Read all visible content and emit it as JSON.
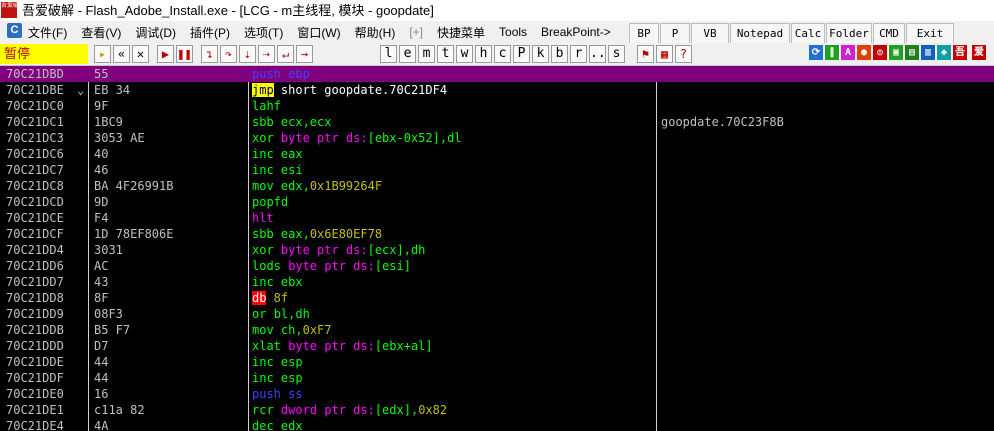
{
  "window": {
    "title": "吾爱破解 - Flash_Adobe_Install.exe - [LCG - m主线程, 模块 - goopdate]",
    "logo_text": "吾爱破解"
  },
  "menu": {
    "logo": "C",
    "items": [
      "文件(F)",
      "查看(V)",
      "调试(D)",
      "插件(P)",
      "选项(T)",
      "窗口(W)",
      "帮助(H)",
      "[+]",
      "快捷菜单",
      "Tools",
      "BreakPoint->"
    ]
  },
  "quickbar": [
    "BP",
    "P",
    "VB",
    "Notepad",
    "Calc",
    "Folder",
    "CMD",
    "Exit"
  ],
  "toolbar": {
    "status": "暂停",
    "letters": [
      "l",
      "e",
      "m",
      "t",
      "w",
      "h",
      "c",
      "P",
      "k",
      "b",
      "r",
      "...",
      "s"
    ],
    "right_icons": [
      "refresh-icon",
      "pause-bars-icon",
      "A-icon",
      "stop-circle-icon",
      "target-icon",
      "plugin-icon",
      "debug-icon",
      "stack-icon",
      "logo-icon",
      "heart-icon",
      "app-icon"
    ],
    "right_labels": [
      "吾",
      "爱"
    ]
  },
  "colors": {
    "selected_row": "#800080",
    "mnemonic": "#00ff00",
    "keyword": "#ff00ff",
    "constant": "#c0c000",
    "highlight_jmp": "#ffff00",
    "highlight_db": "#ff0000"
  },
  "disasm": [
    {
      "addr": "70C21DBD",
      "hex": "55",
      "segs": [
        {
          "t": "push ",
          "c": "push"
        },
        {
          "t": "ebp",
          "c": "reg"
        }
      ],
      "comment": "",
      "selected": true
    },
    {
      "addr": "70C21DBE",
      "hex": "EB 34",
      "arrow": "⌄",
      "segs": [
        {
          "t": "jmp",
          "c": "jmp"
        },
        {
          "t": " short goopdate.70C21DF4",
          "c": "white"
        }
      ],
      "comment": ""
    },
    {
      "addr": "70C21DC0",
      "hex": "9F",
      "segs": [
        {
          "t": "lahf",
          "c": "ins"
        }
      ],
      "comment": ""
    },
    {
      "addr": "70C21DC1",
      "hex": "1BC9",
      "segs": [
        {
          "t": "sbb ",
          "c": "ins"
        },
        {
          "t": "ecx,ecx",
          "c": "ins"
        }
      ],
      "comment": "goopdate.70C23F8B"
    },
    {
      "addr": "70C21DC3",
      "hex": "3053 AE",
      "segs": [
        {
          "t": "xor ",
          "c": "ins"
        },
        {
          "t": "byte ptr ds:",
          "c": "kw"
        },
        {
          "t": "[ebx-0x52],dl",
          "c": "ins"
        }
      ],
      "comment": ""
    },
    {
      "addr": "70C21DC6",
      "hex": "40",
      "segs": [
        {
          "t": "inc ",
          "c": "ins"
        },
        {
          "t": "eax",
          "c": "ins"
        }
      ],
      "comment": ""
    },
    {
      "addr": "70C21DC7",
      "hex": "46",
      "segs": [
        {
          "t": "inc ",
          "c": "ins"
        },
        {
          "t": "esi",
          "c": "ins"
        }
      ],
      "comment": ""
    },
    {
      "addr": "70C21DC8",
      "hex": "BA 4F26991B",
      "segs": [
        {
          "t": "mov ",
          "c": "ins"
        },
        {
          "t": "edx,",
          "c": "ins"
        },
        {
          "t": "0x1B99264F",
          "c": "const"
        }
      ],
      "comment": ""
    },
    {
      "addr": "70C21DCD",
      "hex": "9D",
      "segs": [
        {
          "t": "popfd",
          "c": "ins"
        }
      ],
      "comment": ""
    },
    {
      "addr": "70C21DCE",
      "hex": "F4",
      "segs": [
        {
          "t": "hlt",
          "c": "kw"
        }
      ],
      "comment": ""
    },
    {
      "addr": "70C21DCF",
      "hex": "1D 78EF806E",
      "segs": [
        {
          "t": "sbb ",
          "c": "ins"
        },
        {
          "t": "eax,",
          "c": "ins"
        },
        {
          "t": "0x6E80EF78",
          "c": "const"
        }
      ],
      "comment": ""
    },
    {
      "addr": "70C21DD4",
      "hex": "3031",
      "segs": [
        {
          "t": "xor ",
          "c": "ins"
        },
        {
          "t": "byte ptr ds:",
          "c": "kw"
        },
        {
          "t": "[ecx],dh",
          "c": "ins"
        }
      ],
      "comment": ""
    },
    {
      "addr": "70C21DD6",
      "hex": "AC",
      "segs": [
        {
          "t": "lods ",
          "c": "ins"
        },
        {
          "t": "byte ptr ds:",
          "c": "kw"
        },
        {
          "t": "[esi]",
          "c": "ins"
        }
      ],
      "comment": ""
    },
    {
      "addr": "70C21DD7",
      "hex": "43",
      "segs": [
        {
          "t": "inc ",
          "c": "ins"
        },
        {
          "t": "ebx",
          "c": "ins"
        }
      ],
      "comment": ""
    },
    {
      "addr": "70C21DD8",
      "hex": "8F",
      "segs": [
        {
          "t": "db",
          "c": "db"
        },
        {
          "t": " 8f",
          "c": "const"
        }
      ],
      "comment": ""
    },
    {
      "addr": "70C21DD9",
      "hex": "08F3",
      "segs": [
        {
          "t": "or ",
          "c": "ins"
        },
        {
          "t": "bl,dh",
          "c": "ins"
        }
      ],
      "comment": ""
    },
    {
      "addr": "70C21DDB",
      "hex": "B5 F7",
      "segs": [
        {
          "t": "mov ",
          "c": "ins"
        },
        {
          "t": "ch,",
          "c": "ins"
        },
        {
          "t": "0xF7",
          "c": "const"
        }
      ],
      "comment": ""
    },
    {
      "addr": "70C21DDD",
      "hex": "D7",
      "segs": [
        {
          "t": "xlat ",
          "c": "ins"
        },
        {
          "t": "byte ptr ds:",
          "c": "kw"
        },
        {
          "t": "[ebx+al]",
          "c": "ins"
        }
      ],
      "comment": ""
    },
    {
      "addr": "70C21DDE",
      "hex": "44",
      "segs": [
        {
          "t": "inc ",
          "c": "ins"
        },
        {
          "t": "esp",
          "c": "ins"
        }
      ],
      "comment": ""
    },
    {
      "addr": "70C21DDF",
      "hex": "44",
      "segs": [
        {
          "t": "inc ",
          "c": "ins"
        },
        {
          "t": "esp",
          "c": "ins"
        }
      ],
      "comment": ""
    },
    {
      "addr": "70C21DE0",
      "hex": "16",
      "segs": [
        {
          "t": "push ",
          "c": "push"
        },
        {
          "t": "ss",
          "c": "push"
        }
      ],
      "comment": ""
    },
    {
      "addr": "70C21DE1",
      "hex": "c11a 82",
      "segs": [
        {
          "t": "rcr ",
          "c": "ins"
        },
        {
          "t": "dword ptr ds:",
          "c": "kw"
        },
        {
          "t": "[edx],",
          "c": "ins"
        },
        {
          "t": "0x82",
          "c": "const"
        }
      ],
      "comment": ""
    },
    {
      "addr": "70C21DE4",
      "hex": "4A",
      "segs": [
        {
          "t": "dec ",
          "c": "ins"
        },
        {
          "t": "edx",
          "c": "ins"
        }
      ],
      "comment": ""
    }
  ]
}
